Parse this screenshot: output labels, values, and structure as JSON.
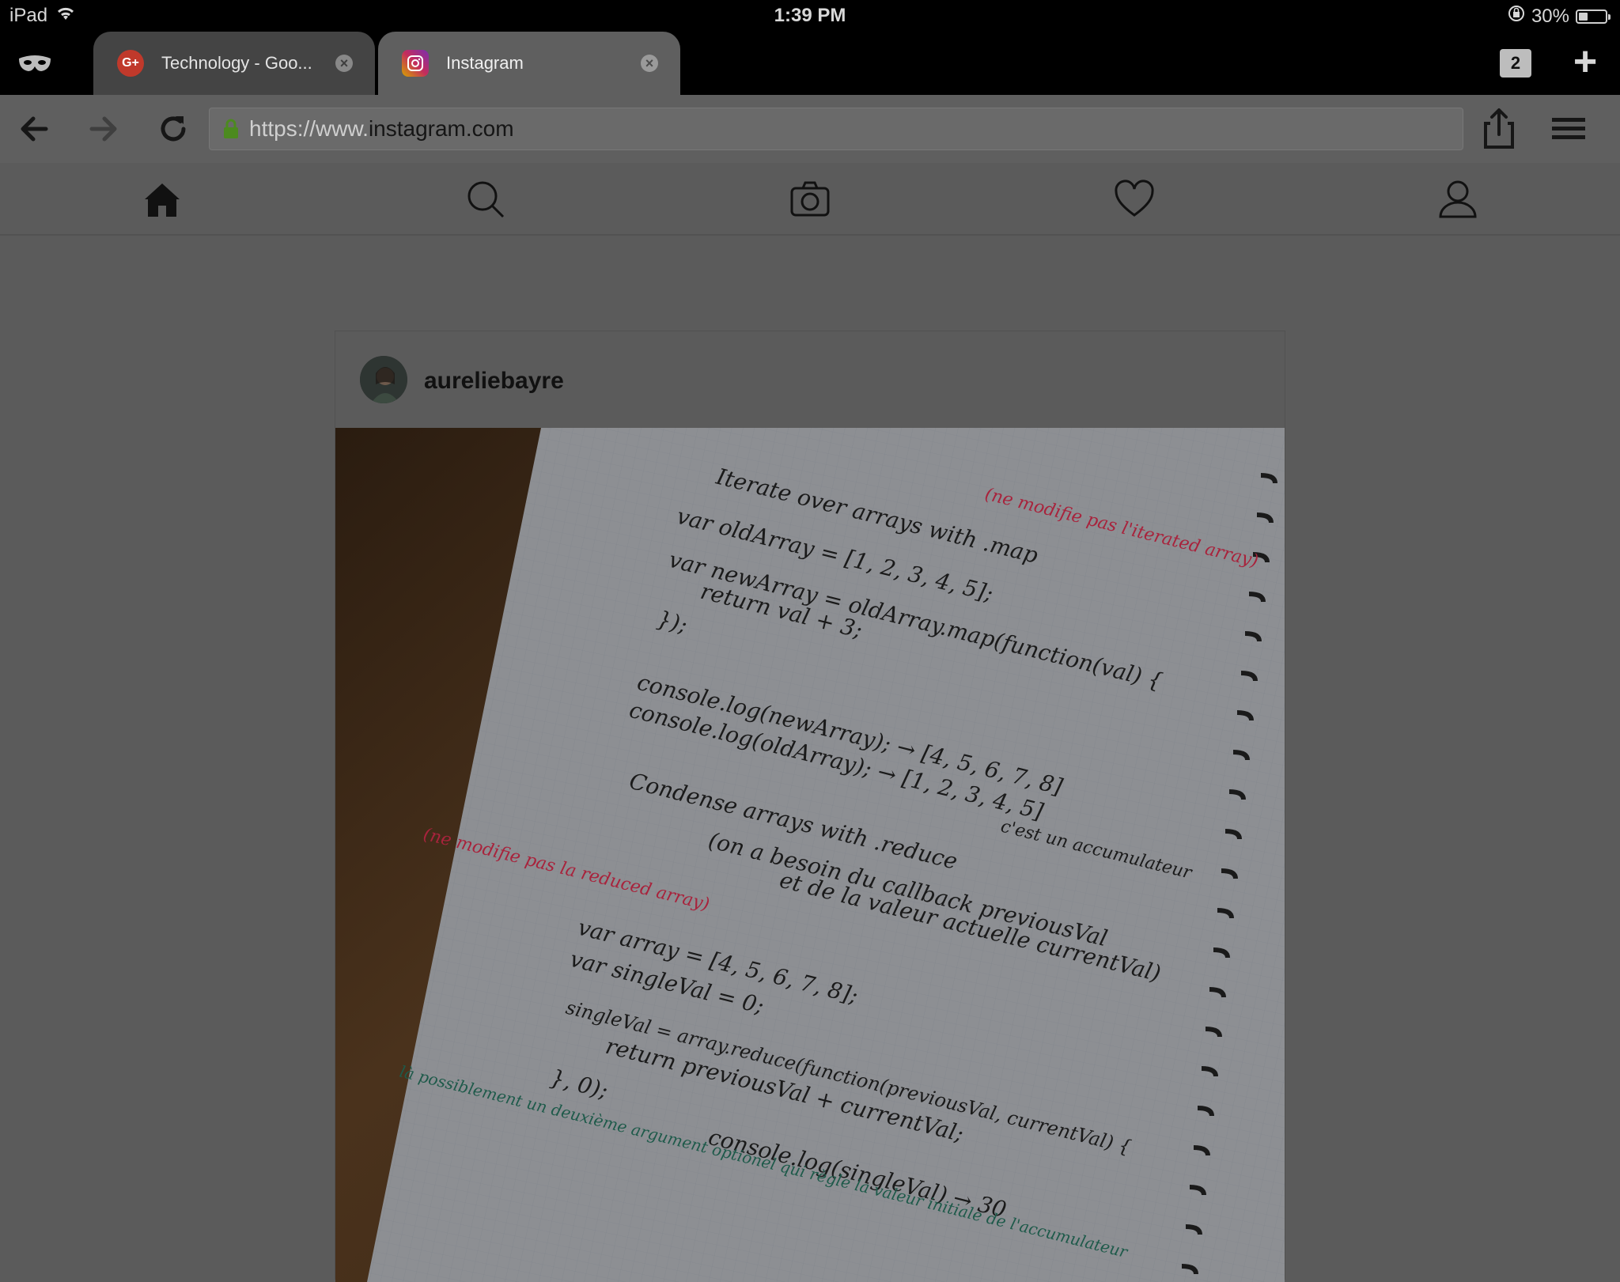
{
  "status_bar": {
    "device": "iPad",
    "time": "1:39 PM",
    "battery_percent": "30%",
    "battery_level": 0.3
  },
  "tabs": [
    {
      "title": "Technology - Goo...",
      "favicon": "google-plus-icon",
      "active": false
    },
    {
      "title": "Instagram",
      "favicon": "instagram-icon",
      "active": true
    }
  ],
  "tab_count": "2",
  "toolbar": {
    "url_prefix": "https://www.",
    "url_domain": "instagram.com"
  },
  "nav": {
    "items": [
      "home-icon",
      "search-icon",
      "camera-icon",
      "heart-icon",
      "profile-icon"
    ]
  },
  "post": {
    "username": "aureliebayre",
    "notes": {
      "line1": "Iterate over arrays with .map",
      "line2": "var oldArray = [1, 2, 3, 4, 5];",
      "line3": "var newArray = oldArray.map(function(val) {",
      "line4": "return val + 3;",
      "line5": "});",
      "line6": "console.log(newArray); → [4, 5, 6, 7, 8]",
      "line7": "console.log(oldArray); → [1, 2, 3, 4, 5]",
      "line8": "Condense arrays with .reduce",
      "line9": "(on a besoin du callback previousVal",
      "line10": "et de la valeur actuelle currentVal)",
      "line11": "var array = [4, 5, 6, 7, 8];",
      "line12": "var singleVal = 0;",
      "line13": "singleVal = array.reduce(function(previousVal, currentVal) {",
      "line14": "return previousVal + currentVal;",
      "line15": "}, 0);",
      "line16": "console.log(singleVal) → 30",
      "red_note1": "(ne modifie pas l'iterated array)",
      "red_note2": "(ne modifie pas la reduced array)",
      "red_note3": "c'est un accumulateur",
      "green_note": "là possiblement un deuxième argument optionel qui règle la valeur initiale de l'accumulateur"
    }
  },
  "colors": {
    "overlay_bg": "#5b5b5b",
    "tab_bar": "#000000",
    "ink": "#1a1a1a",
    "red_ink": "#a8233c",
    "green_ink": "#1e5a4a"
  }
}
